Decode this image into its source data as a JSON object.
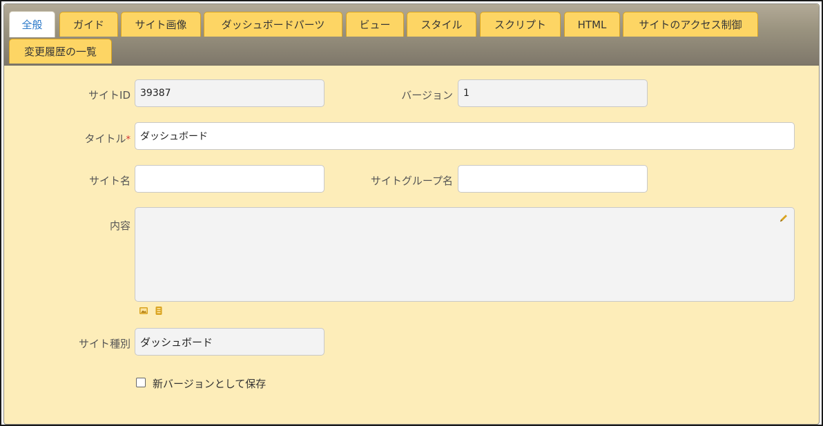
{
  "tabs": [
    {
      "label": "全般",
      "active": true
    },
    {
      "label": "ガイド"
    },
    {
      "label": "サイト画像"
    },
    {
      "label": "ダッシュボードパーツ"
    },
    {
      "label": "ビュー"
    },
    {
      "label": "スタイル"
    },
    {
      "label": "スクリプト"
    },
    {
      "label": "HTML"
    },
    {
      "label": "サイトのアクセス制御"
    },
    {
      "label": "変更履歴の一覧"
    }
  ],
  "form": {
    "site_id": {
      "label": "サイトID",
      "value": "39387"
    },
    "version": {
      "label": "バージョン",
      "value": "1"
    },
    "title": {
      "label": "タイトル",
      "required_mark": "*",
      "value": "ダッシュボード"
    },
    "site_name": {
      "label": "サイト名",
      "value": ""
    },
    "site_group_name": {
      "label": "サイトグループ名",
      "value": ""
    },
    "content": {
      "label": "内容",
      "value": ""
    },
    "site_type": {
      "label": "サイト種別",
      "value": "ダッシュボード"
    },
    "save_new_version": {
      "label": "新バージョンとして保存",
      "checked": false
    }
  },
  "colors": {
    "panel_bg": "#fdedb9",
    "tab_bg": "#fdd564",
    "tab_active_text": "#2a78c8",
    "icon_accent": "#d9a31f"
  },
  "icons": [
    "pencil-icon",
    "image-icon",
    "attachment-icon"
  ]
}
